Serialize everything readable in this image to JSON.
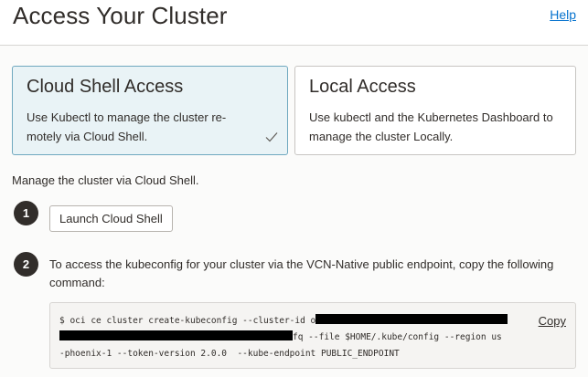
{
  "header": {
    "title": "Access Your Cluster",
    "help_label": "Help"
  },
  "access_options": [
    {
      "title": "Cloud Shell Access",
      "description": "Use Kubectl to manage the cluster re-motely via Cloud Shell.",
      "selected": true
    },
    {
      "title": "Local Access",
      "description": "Use kubectl and the Kubernetes Dashboard to manage the cluster Locally.",
      "selected": false
    }
  ],
  "intro": "Manage the cluster via Cloud Shell.",
  "steps": [
    {
      "number": "1",
      "button_label": "Launch Cloud Shell"
    },
    {
      "number": "2",
      "text": "To access the kubeconfig for your cluster via the VCN-Native public endpoint, copy the following command:"
    }
  ],
  "command": {
    "line1": "$ oci ce cluster create-kubeconfig --cluster-id o",
    "line2_end": "fq --file $HOME/.kube/config --region us",
    "line3": "-phoenix-1 --token-version 2.0.0  --kube-endpoint PUBLIC_ENDPOINT",
    "copy_label": "Copy"
  },
  "icons": {
    "checkmark": "check-icon"
  },
  "colors": {
    "accent_link": "#0572ce",
    "selected_card_bg": "#e9f3f6",
    "step_badge": "#312d2a"
  }
}
